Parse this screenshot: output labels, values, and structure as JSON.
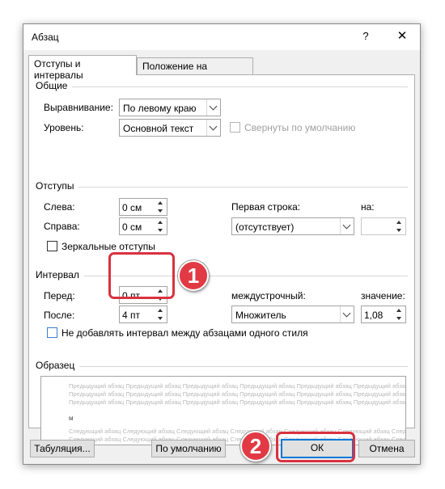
{
  "window": {
    "title": "Абзац",
    "help_label": "?",
    "close_label": "✕"
  },
  "tabs": [
    {
      "label": "Отступы и интервалы",
      "active": true
    },
    {
      "label": "Положение на странице",
      "active": false
    }
  ],
  "general": {
    "section_label": "Общие",
    "alignment_label": "Выравнивание:",
    "alignment_value": "По левому краю",
    "level_label": "Уровень:",
    "level_value": "Основной текст",
    "collapsed_label": "Свернуты по умолчанию"
  },
  "indents": {
    "section_label": "Отступы",
    "left_label": "Слева:",
    "left_value": "0 см",
    "right_label": "Справа:",
    "right_value": "0 см",
    "first_line_label": "Первая строка:",
    "first_line_value": "(отсутствует)",
    "by_label": "на:",
    "by_value": "",
    "mirror_label": "Зеркальные отступы"
  },
  "spacing": {
    "section_label": "Интервал",
    "before_label": "Перед:",
    "before_value": "0 пт",
    "after_label": "После:",
    "after_value": "4 пт",
    "line_spacing_label": "междустрочный:",
    "line_spacing_value": "Множитель",
    "at_label": "значение:",
    "at_value": "1,08",
    "no_space_label": "Не добавлять интервал между абзацами одного стиля"
  },
  "preview": {
    "section_label": "Образец",
    "prev_text": "Предыдущий абзац Предыдущий абзац Предыдущий абзац Предыдущий абзац Предыдущий абзац Предыдущий абзац",
    "current_text": "м",
    "next_text": "Следующий абзац Следующий абзац Следующий абзац Следующий абзац Следующий абзац Следующий абзац Следующий абзац"
  },
  "buttons": {
    "tabs_label": "Табуляция...",
    "default_label": "По умолчанию",
    "ok_label": "ОК",
    "cancel_label": "Отмена"
  },
  "annotations": {
    "badge1": "1",
    "badge2": "2",
    "accent_color": "#e23a45"
  }
}
